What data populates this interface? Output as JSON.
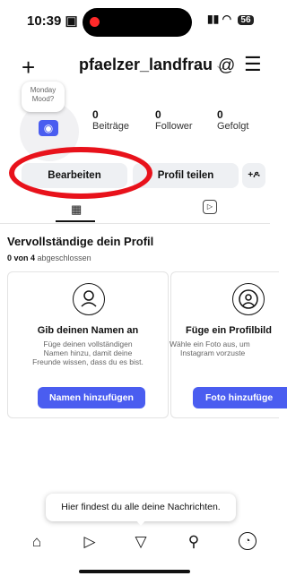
{
  "status_bar": {
    "time": "10:39",
    "signal": "…",
    "battery": "56"
  },
  "header": {
    "username": "pfaelzer_landfrau",
    "dropdown": "⌵"
  },
  "note_bubble": {
    "line1": "Monday",
    "line2": "Mood?"
  },
  "stats": [
    {
      "number": "0",
      "label": "Beiträge"
    },
    {
      "number": "0",
      "label": "Follower"
    },
    {
      "number": "0",
      "label": "Gefolgt"
    }
  ],
  "buttons": {
    "edit": "Bearbeiten",
    "share": "Profil teilen",
    "add_person": "+ዶ"
  },
  "complete_profile": {
    "title": "Vervollständige dein Profil",
    "progress_bold": "0 von 4",
    "progress_rest": "abgeschlossen"
  },
  "cards": [
    {
      "title": "Gib deinen Namen an",
      "desc1": "Füge deinen vollständigen",
      "desc2": "Namen hinzu, damit deine",
      "desc3": "Freunde wissen, dass du es bist.",
      "button": "Namen hinzufügen"
    },
    {
      "title": "Füge ein Profilbild",
      "desc1": "Wähle ein Foto aus, um",
      "desc2": "Instagram vorzuste",
      "button": "Foto hinzufüge"
    }
  ],
  "tooltip": "Hier findest du alle deine Nachrichten.",
  "colors": {
    "accent": "#4a5df0",
    "annotation": "#e8121b"
  }
}
